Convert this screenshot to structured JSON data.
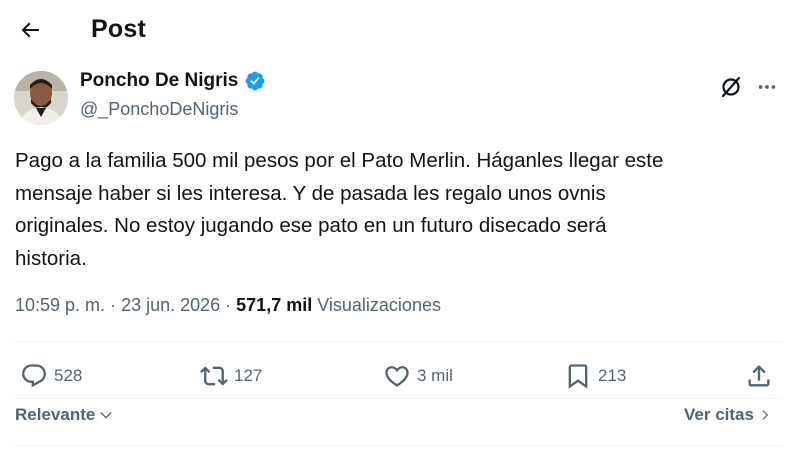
{
  "header": {
    "title": "Post",
    "back_icon": "arrow-left-icon"
  },
  "author": {
    "name": "Poncho De Nigris",
    "handle": "@_PonchoDeNigris",
    "verified_color": "#1d9bf0"
  },
  "post": {
    "text": "Pago a la familia 500 mil pesos por el Pato Merlin. Háganles llegar este\nmensaje haber si les interesa.  Y de pasada les regalo unos ovnis\noriginales.  No estoy jugando ese pato en un futuro disecado será\nhistoria.",
    "time": "10:59 p. m.",
    "date": "23 jun. 2026",
    "separator": "·",
    "views_count": "571,7 mil",
    "views_label": "Visualizaciones"
  },
  "actions": {
    "replies": "528",
    "reposts": "127",
    "likes": "3 mil",
    "bookmarks": "213"
  },
  "footer": {
    "sort_label": "Relevante",
    "quotes_label": "Ver citas"
  },
  "colors": {
    "text_primary": "#0f1419",
    "text_secondary": "#536471",
    "accent": "#1d9bf0",
    "divider": "#eff3f4"
  }
}
